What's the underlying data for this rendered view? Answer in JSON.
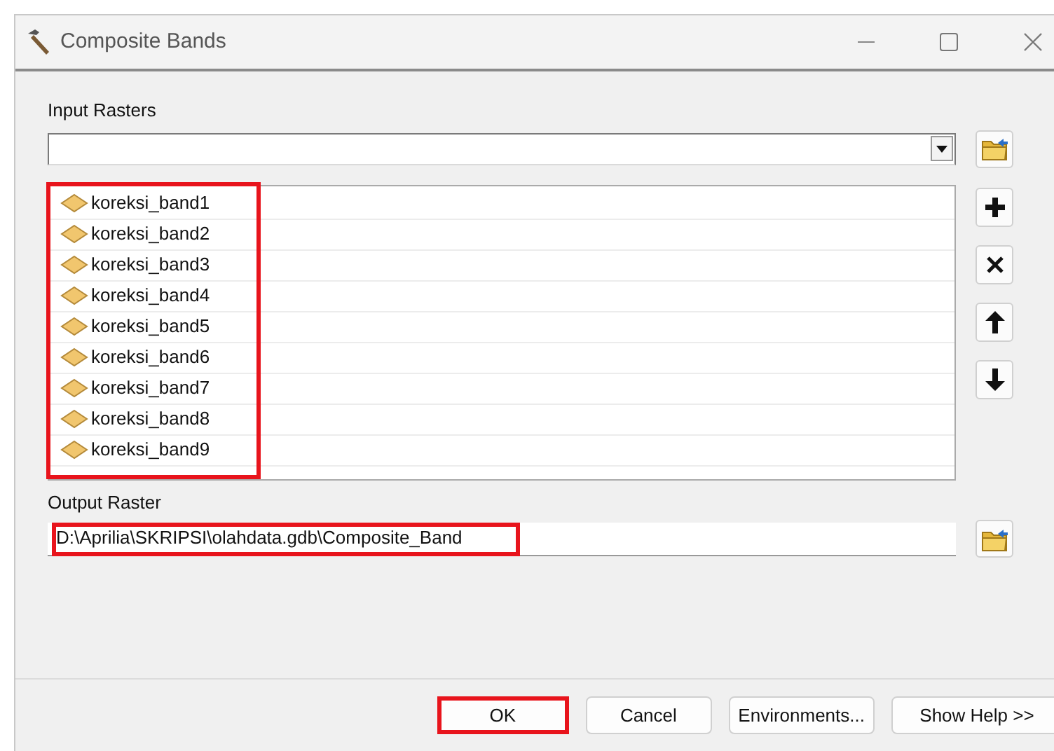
{
  "window": {
    "title": "Composite Bands"
  },
  "input_rasters": {
    "label": "Input Rasters",
    "highlighted": true,
    "items": [
      {
        "name": "koreksi_band1"
      },
      {
        "name": "koreksi_band2"
      },
      {
        "name": "koreksi_band3"
      },
      {
        "name": "koreksi_band4"
      },
      {
        "name": "koreksi_band5"
      },
      {
        "name": "koreksi_band6"
      },
      {
        "name": "koreksi_band7"
      },
      {
        "name": "koreksi_band8"
      },
      {
        "name": "koreksi_band9"
      }
    ]
  },
  "list_buttons": [
    {
      "kind": "add"
    },
    {
      "kind": "remove"
    },
    {
      "kind": "up"
    },
    {
      "kind": "down"
    }
  ],
  "output_raster": {
    "label": "Output Raster",
    "value": "D:\\Aprilia\\SKRIPSI\\olahdata.gdb\\Composite_Band",
    "highlighted": true
  },
  "buttons": [
    {
      "label": "OK",
      "highlighted": true
    },
    {
      "label": "Cancel",
      "highlighted": false
    },
    {
      "label": "Environments...",
      "highlighted": false
    },
    {
      "label": "Show Help >>",
      "highlighted": false
    }
  ]
}
